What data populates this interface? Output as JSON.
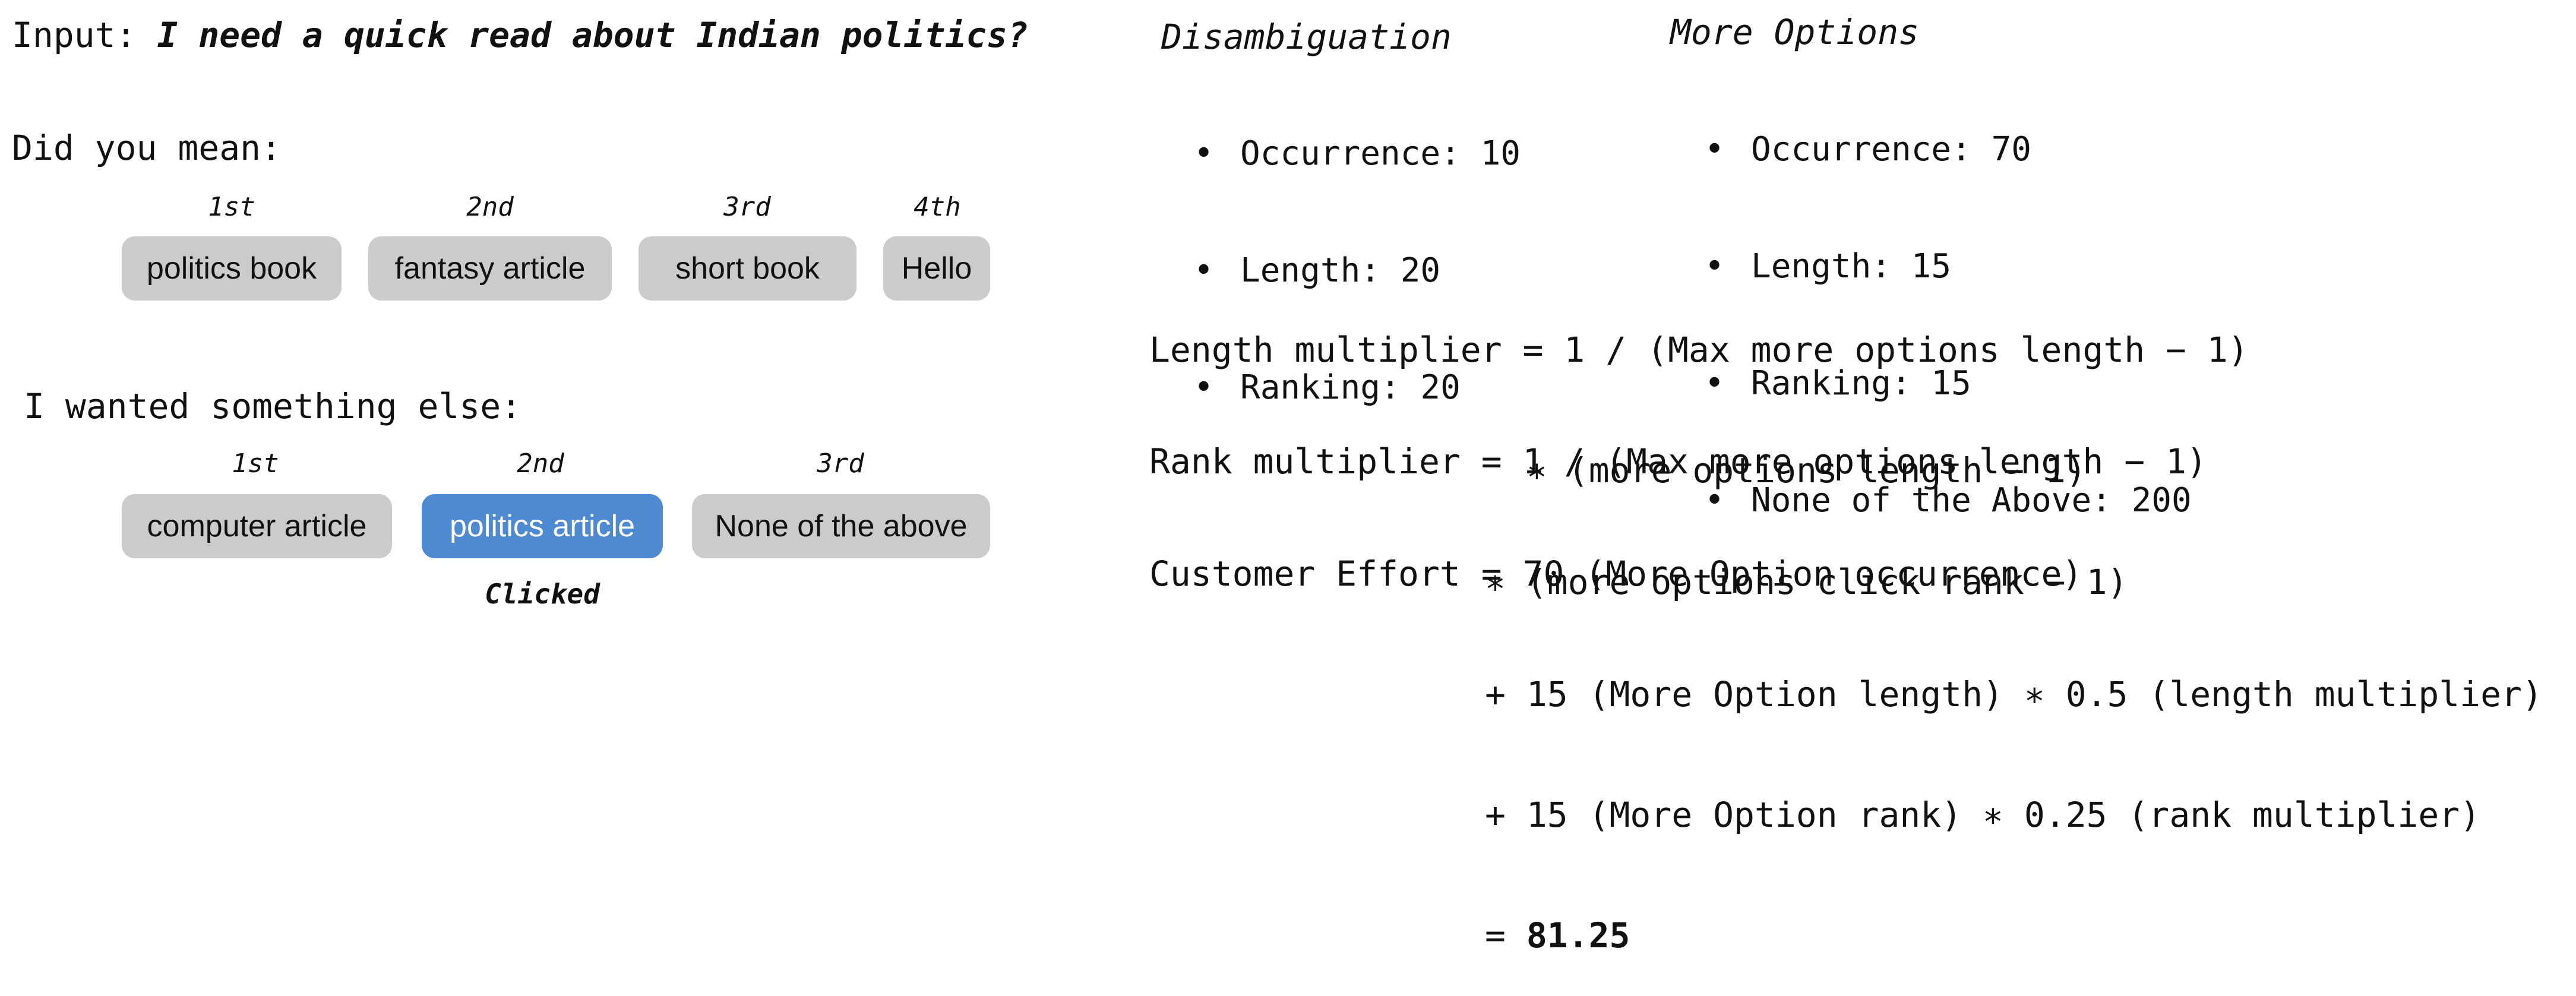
{
  "input": {
    "label": "Input:",
    "query": "I need a quick read about Indian politics?"
  },
  "did_you_mean": {
    "heading": "Did you mean:",
    "options": [
      {
        "rank": "1st",
        "label": "politics book"
      },
      {
        "rank": "2nd",
        "label": "fantasy article"
      },
      {
        "rank": "3rd",
        "label": "short book"
      },
      {
        "rank": "4th",
        "label": "Hello"
      }
    ]
  },
  "something_else": {
    "heading": "I wanted something else:",
    "options": [
      {
        "rank": "1st",
        "label": "computer article"
      },
      {
        "rank": "2nd",
        "label": "politics article"
      },
      {
        "rank": "3rd",
        "label": "None of the above"
      }
    ],
    "clicked_label": "Clicked"
  },
  "disambiguation": {
    "title": "Disambiguation",
    "items": [
      "Occurrence: 10",
      "Length: 20",
      "Ranking: 20"
    ]
  },
  "more_options": {
    "title": "More Options",
    "items": [
      "Occurrence: 70",
      "Length: 15",
      "Ranking: 15",
      "None of the Above: 200"
    ]
  },
  "formulas": {
    "length_multiplier": {
      "lhs": "Length multiplier",
      "line1": "= 1 / (Max more options length − 1)",
      "line2": "∗ (more options length − 1)"
    },
    "rank_multiplier": {
      "lhs": "Rank multiplier",
      "line1": "= 1 / (Max more options length − 1)",
      "line2": "∗ (more options click rank − 1)"
    },
    "customer_effort": {
      "lhs": "Customer Effort",
      "line1": "= 70 (More Option occurrence)",
      "line2": "+ 15 (More Option length) ∗ 0.5 (length multiplier)",
      "line3": "+ 15 (More Option rank) ∗ 0.25 (rank multiplier)",
      "result_prefix": "= ",
      "result": "81.25"
    }
  }
}
